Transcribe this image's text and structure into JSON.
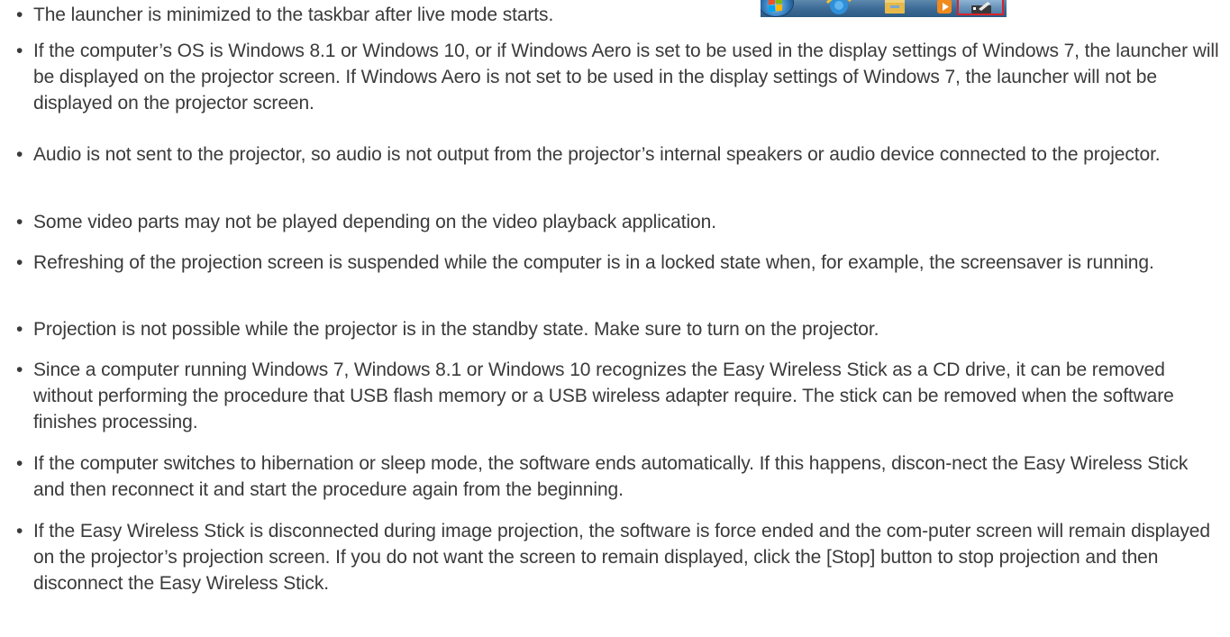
{
  "bullets": [
    {
      "marker": "•",
      "text": "The launcher is minimized to the taskbar after live mode starts."
    },
    {
      "marker": "•",
      "text": "If the computer’s OS is Windows 8.1 or Windows 10, or if Windows Aero is set to be used in the display settings of Windows 7, the launcher will be displayed on the projector screen. If Windows Aero is not set to be used in the display settings of Windows 7, the launcher will not be displayed on the projector screen."
    },
    {
      "marker": "•",
      "text": "Audio is not sent to the projector, so audio is not output from the projector’s internal speakers or audio device connected to the projector."
    },
    {
      "marker": "•",
      "text": "Some video parts may not be played depending on the video playback application."
    },
    {
      "marker": "•",
      "text": "Refreshing of the projection screen is suspended while the computer is in a locked state when, for example, the screensaver is running."
    },
    {
      "marker": "•",
      "text": "Projection is not possible while the projector is in the standby state. Make sure to turn on the projector."
    },
    {
      "marker": "•",
      "text": "Since a computer running Windows 7, Windows 8.1 or Windows 10 recognizes the Easy Wireless Stick as a CD drive, it can be removed without performing the procedure that USB flash memory or a USB wireless adapter require. The stick can be removed when the software finishes processing."
    },
    {
      "marker": "•",
      "text": "If the computer switches to hibernation or sleep mode, the software ends automatically. If this happens, discon-nect the Easy Wireless Stick and then reconnect it and start the procedure again from the beginning."
    },
    {
      "marker": "•",
      "text": "If the Easy Wireless Stick is disconnected during image projection, the software is force ended and the com-puter screen will remain displayed on the projector’s projection screen. If you do not want the screen to remain displayed, click the [Stop] button to stop projection and then disconnect the Easy Wireless Stick."
    }
  ],
  "taskbar_image": {
    "icons": [
      "windows-start-icon",
      "internet-explorer-icon",
      "file-explorer-folder-icon",
      "media-player-icon",
      "launcher-icon"
    ],
    "highlight_color": "#d8232a",
    "highlighted_icon": "launcher-icon"
  },
  "colors": {
    "text": "#3a3a3a",
    "background": "#ffffff",
    "taskbar": "#3f6e99"
  }
}
